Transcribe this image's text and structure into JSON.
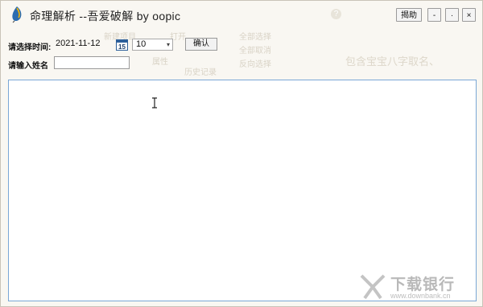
{
  "window": {
    "title": "命理解析 --吾爱破解 by oopic",
    "buttons": {
      "support": "揭助",
      "minimize": "-",
      "maximize": "·",
      "close": "×"
    }
  },
  "form": {
    "date_label": "请选择时间:",
    "date_value": "2021-11-12",
    "calendar_day": "15",
    "hour_value": "10",
    "confirm_label": "确认",
    "name_label": "请输入姓名",
    "name_value": ""
  },
  "background_ghost": {
    "new_project": "新建项目",
    "open": "打开",
    "select_all": "全部选择",
    "deselect_all": "全部取消",
    "invert_select": "反向选择",
    "properties": "属性",
    "history": "历史记录",
    "content_hint": "包含宝宝八字取名、"
  },
  "watermark": {
    "brand": "下载银行",
    "url": "www.downbank.cn"
  },
  "colors": {
    "text_area_border": "#7aa7d6",
    "window_bg": "#f9f7f2"
  }
}
